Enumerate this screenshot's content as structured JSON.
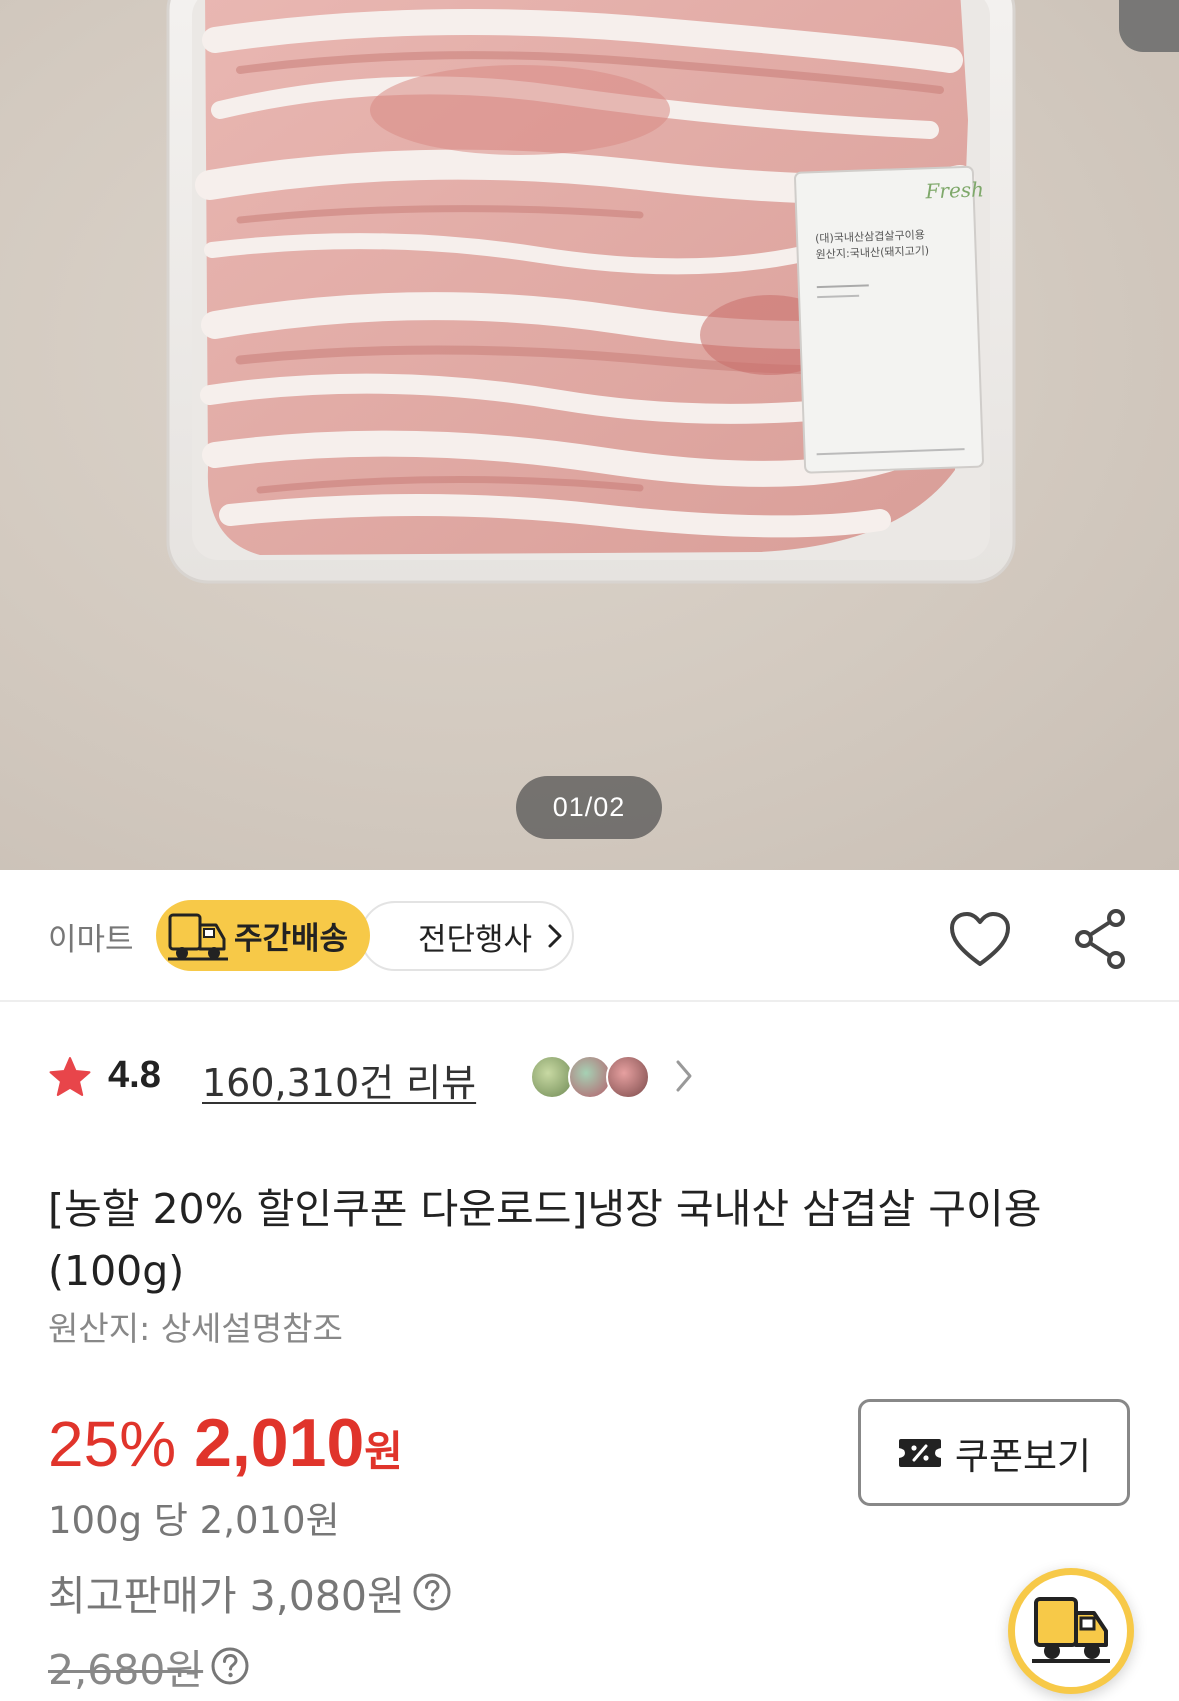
{
  "gallery": {
    "image_alt": "냉장 국내산 삼겹살 구이용 포장 사진",
    "pager": "01/02",
    "label_brand": "Fresh",
    "label_line1": "(대)국내산삼겹살구이용",
    "label_line2": "원산지:국내산(돼지고기)"
  },
  "store": {
    "name": "이마트",
    "weekly_delivery": "주간배송",
    "event_label": "전단행사"
  },
  "rating": {
    "value": "4.8",
    "reviews": "160,310건 리뷰"
  },
  "product": {
    "title": "[농할 20% 할인쿠폰 다운로드]냉장 국내산 삼겹살 구이용 (100g)",
    "origin": "원산지: 상세설명참조"
  },
  "price": {
    "discount": "25%",
    "amount": "2,010",
    "currency": "원",
    "unit_price": "100g 당 2,010원",
    "max_price": "최고판매가 3,080원",
    "original_price": "2,680원"
  },
  "coupon": {
    "label": "쿠폰보기"
  },
  "colors": {
    "accent_red": "#e0342b",
    "delivery_yellow": "#f7c948"
  },
  "icons": [
    "truck-icon",
    "chevron-right-icon",
    "heart-icon",
    "share-icon",
    "star-icon",
    "help-icon",
    "coupon-icon"
  ]
}
